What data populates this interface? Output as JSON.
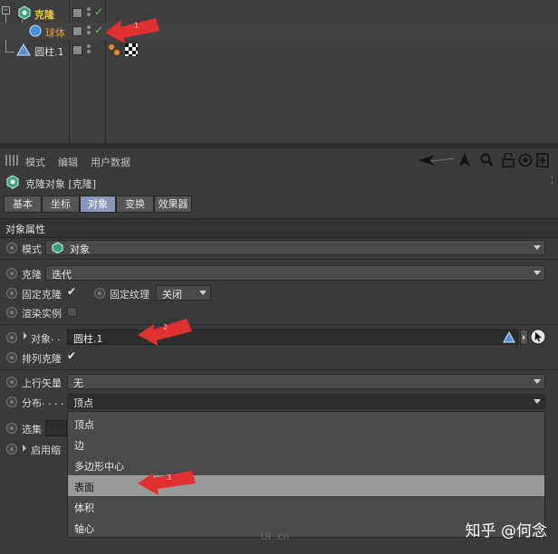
{
  "object_manager": {
    "rows": [
      {
        "name": "克隆",
        "color": "#e8c240"
      },
      {
        "name": "球体",
        "color": "#e8a030"
      },
      {
        "name": "圆柱.1",
        "color": "#d8d8d8"
      }
    ],
    "annotation": "1"
  },
  "attribute_manager": {
    "menu": [
      "模式",
      "编辑",
      "用户数据"
    ],
    "object_title": "克隆对象 [克隆]",
    "tabs": [
      "基本",
      "坐标",
      "对象",
      "变换",
      "效果器"
    ],
    "active_tab": "对象",
    "section_title": "对象属性",
    "params": {
      "mode": {
        "label": "模式",
        "value": "对象"
      },
      "clone": {
        "label": "克隆",
        "value": "迭代"
      },
      "fixed_clone": {
        "label": "固定克隆"
      },
      "fixed_texture": {
        "label": "固定纹理",
        "value": "关闭"
      },
      "render_instances": {
        "label": "渲染实例"
      },
      "object": {
        "label": "对象",
        "dots": ". .",
        "value": "圆柱.1"
      },
      "align_clone": {
        "label": "排列克隆"
      },
      "up_vector": {
        "label": "上行矢量",
        "value": "无"
      },
      "distribution": {
        "label": "分布",
        "dots": ". . . .",
        "value": "顶点"
      },
      "selection": {
        "label": "选集"
      },
      "enable_scale": {
        "label": "启用缩"
      }
    },
    "annotation_2": "2",
    "annotation_3": "3",
    "dropdown_options": [
      "顶点",
      "边",
      "多边形中心",
      "表面",
      "体积",
      "轴心"
    ],
    "highlighted_option": "表面"
  },
  "watermark": "知乎 @何念",
  "ui_badge": "UI .cn",
  "colors": {
    "accent_tab": "#8898b8",
    "check_green": "#5fd35f",
    "arrow_red": "#e03030"
  }
}
